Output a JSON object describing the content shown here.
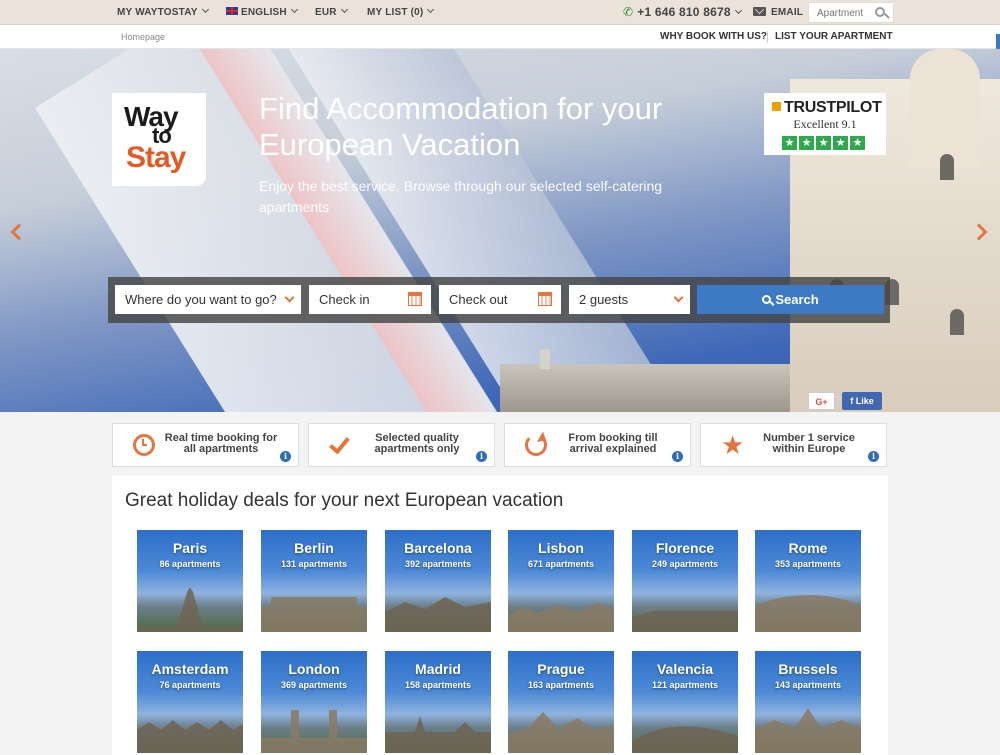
{
  "topbar": {
    "site_menu": "MY WAYTOSTAY",
    "language": "ENGLISH",
    "currency": "EUR",
    "my_list": "MY LIST (0)",
    "phone": "+1 646 810 8678",
    "email": "EMAIL",
    "search_placeholder": "Apartment"
  },
  "subbar": {
    "breadcrumb": "Homepage",
    "why_book": "WHY BOOK WITH US?",
    "list_apartment": "LIST YOUR APARTMENT"
  },
  "hero": {
    "logo": {
      "line1": "Way",
      "line2": "to",
      "line3": "Stay"
    },
    "title": "Find Accommodation for your European Vacation",
    "subtitle": "Enjoy the best service. Browse through our selected self-catering apartments",
    "trustpilot": {
      "name": "TRUSTPILOT",
      "score": "Excellent 9.1",
      "stars": 5
    },
    "search": {
      "destination": "Where do you want to go?",
      "checkin": "Check in",
      "checkout": "Check out",
      "guests": "2 guests",
      "button": "Search"
    },
    "social": {
      "gplus": "G+",
      "like": "Like"
    }
  },
  "features": [
    {
      "text": "Real time booking for all apartments",
      "icon": "clock-icon"
    },
    {
      "text": "Selected quality apartments only",
      "icon": "check-icon"
    },
    {
      "text": "From booking till arrival explained",
      "icon": "refresh-icon"
    },
    {
      "text": "Number 1 service within Europe",
      "icon": "star-icon"
    }
  ],
  "deals": {
    "heading": "Great holiday deals for your next European vacation",
    "cities": [
      {
        "name": "Paris",
        "count": "86 apartments"
      },
      {
        "name": "Berlin",
        "count": "131 apartments"
      },
      {
        "name": "Barcelona",
        "count": "392 apartments"
      },
      {
        "name": "Lisbon",
        "count": "671 apartments"
      },
      {
        "name": "Florence",
        "count": "249 apartments"
      },
      {
        "name": "Rome",
        "count": "353 apartments"
      },
      {
        "name": "Amsterdam",
        "count": "76 apartments"
      },
      {
        "name": "London",
        "count": "369 apartments"
      },
      {
        "name": "Madrid",
        "count": "158 apartments"
      },
      {
        "name": "Prague",
        "count": "163 apartments"
      },
      {
        "name": "Valencia",
        "count": "121 apartments"
      },
      {
        "name": "Brussels",
        "count": "143 apartments"
      }
    ]
  },
  "colors": {
    "accent": "#e5753f",
    "primary": "#3d79c5",
    "topbar": "#ebe3d9"
  }
}
